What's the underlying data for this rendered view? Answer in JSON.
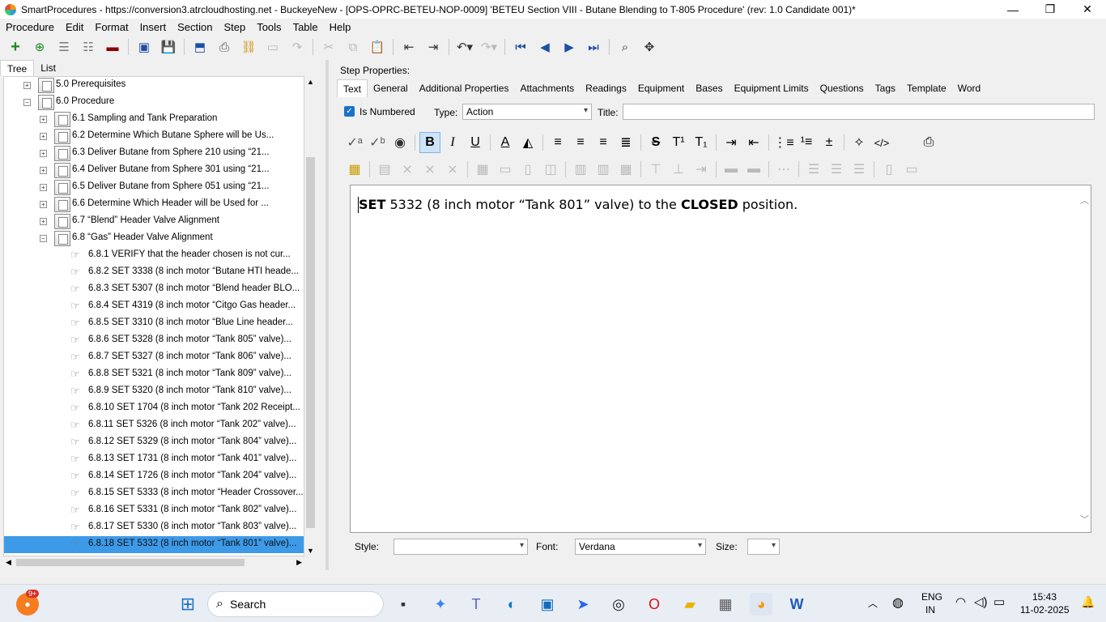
{
  "window": {
    "title": "SmartProcedures - https://conversion3.atrcloudhosting.net - BuckeyeNew - [OPS-OPRC-BETEU-NOP-0009] 'BETEU Section VIII - Butane Blending to T-805 Procedure' (rev: 1.0 Candidate 001)*",
    "minimize": "—",
    "restore": "❐",
    "close": "✕"
  },
  "menu": [
    "Procedure",
    "Edit",
    "Format",
    "Insert",
    "Section",
    "Step",
    "Tools",
    "Table",
    "Help"
  ],
  "left_tabs": [
    "Tree",
    "List"
  ],
  "tree": [
    {
      "label": "5.0 Prerequisites",
      "level": 1,
      "expander": "+",
      "kind": "folder"
    },
    {
      "label": "6.0 Procedure",
      "level": 1,
      "expander": "−",
      "kind": "folder"
    },
    {
      "label": "6.1 Sampling and Tank Preparation",
      "level": 2,
      "expander": "+",
      "kind": "folder"
    },
    {
      "label": "6.2 Determine Which Butane Sphere will be Us...",
      "level": 2,
      "expander": "+",
      "kind": "folder"
    },
    {
      "label": "6.3 Deliver Butane from Sphere 210 using “21...",
      "level": 2,
      "expander": "+",
      "kind": "folder"
    },
    {
      "label": "6.4 Deliver Butane from Sphere 301 using “21...",
      "level": 2,
      "expander": "+",
      "kind": "folder"
    },
    {
      "label": "6.5 Deliver Butane from Sphere 051 using “21...",
      "level": 2,
      "expander": "+",
      "kind": "folder"
    },
    {
      "label": "6.6 Determine Which Header will be Used for ...",
      "level": 2,
      "expander": "+",
      "kind": "folder"
    },
    {
      "label": "6.7 “Blend” Header Valve Alignment",
      "level": 2,
      "expander": "+",
      "kind": "folder"
    },
    {
      "label": "6.8 “Gas” Header Valve Alignment",
      "level": 2,
      "expander": "−",
      "kind": "folder"
    },
    {
      "label": "6.8.1 VERIFY that the header chosen is not cur...",
      "level": 3,
      "kind": "step"
    },
    {
      "label": "6.8.2 SET 3338 (8 inch motor “Butane HTI heade...",
      "level": 3,
      "kind": "step"
    },
    {
      "label": "6.8.3 SET 5307 (8 inch motor “Blend header BLO...",
      "level": 3,
      "kind": "step"
    },
    {
      "label": "6.8.4 SET 4319 (8 inch motor “Citgo Gas header...",
      "level": 3,
      "kind": "step"
    },
    {
      "label": "6.8.5 SET 3310 (8 inch motor “Blue Line header...",
      "level": 3,
      "kind": "step"
    },
    {
      "label": "6.8.6 SET 5328 (8 inch motor “Tank 805” valve)...",
      "level": 3,
      "kind": "step"
    },
    {
      "label": "6.8.7 SET 5327 (8 inch motor “Tank 806” valve)...",
      "level": 3,
      "kind": "step"
    },
    {
      "label": "6.8.8 SET 5321 (8 inch motor “Tank 809” valve)...",
      "level": 3,
      "kind": "step"
    },
    {
      "label": "6.8.9 SET 5320 (8 inch motor “Tank 810” valve)...",
      "level": 3,
      "kind": "step"
    },
    {
      "label": "6.8.10 SET 1704 (8 inch motor “Tank 202 Receipt...",
      "level": 3,
      "kind": "step"
    },
    {
      "label": "6.8.11 SET 5326 (8 inch motor “Tank 202” valve)...",
      "level": 3,
      "kind": "step"
    },
    {
      "label": "6.8.12 SET 5329 (8 inch motor “Tank 804” valve)...",
      "level": 3,
      "kind": "step"
    },
    {
      "label": "6.8.13 SET 1731 (8 inch motor “Tank 401” valve)...",
      "level": 3,
      "kind": "step"
    },
    {
      "label": "6.8.14 SET 1726 (8 inch motor “Tank 204” valve)...",
      "level": 3,
      "kind": "step"
    },
    {
      "label": "6.8.15 SET 5333 (8 inch motor “Header Crossover...",
      "level": 3,
      "kind": "step"
    },
    {
      "label": "6.8.16 SET 5331 (8 inch motor “Tank 802” valve)...",
      "level": 3,
      "kind": "step"
    },
    {
      "label": "6.8.17 SET 5330 (8 inch motor “Tank 803” valve)...",
      "level": 3,
      "kind": "step"
    },
    {
      "label": "6.8.18 SET 5332 (8 inch motor “Tank 801” valve)...",
      "level": 3,
      "kind": "step",
      "selected": true
    }
  ],
  "step_properties": {
    "heading": "Step Properties:",
    "tabs": [
      "Text",
      "General",
      "Additional Properties",
      "Attachments",
      "Readings",
      "Equipment",
      "Bases",
      "Equipment Limits",
      "Questions",
      "Tags",
      "Template",
      "Word"
    ],
    "is_numbered_label": "Is Numbered",
    "is_numbered_checked": true,
    "type_label": "Type:",
    "type_value": "Action",
    "title_label": "Title:",
    "title_value": ""
  },
  "editor": {
    "bold1": "SET",
    "plain1": " 5332 (8 inch motor “Tank 801” valve) to the ",
    "bold2": "CLOSED",
    "plain2": " position."
  },
  "bottom_bar": {
    "style_label": "Style:",
    "style_value": "",
    "font_label": "Font:",
    "font_value": "Verdana",
    "size_label": "Size:",
    "size_value": ""
  },
  "taskbar": {
    "search_placeholder": "Search",
    "notification_badge": "9+",
    "lang_line1": "ENG",
    "lang_line2": "IN",
    "time": "15:43",
    "date": "11-02-2025"
  },
  "colors": {
    "selection": "#3d9ae8",
    "checkbox": "#1a73c8",
    "toolbar_green": "#1e8a1e",
    "toolbar_blue": "#1b4fa3"
  }
}
